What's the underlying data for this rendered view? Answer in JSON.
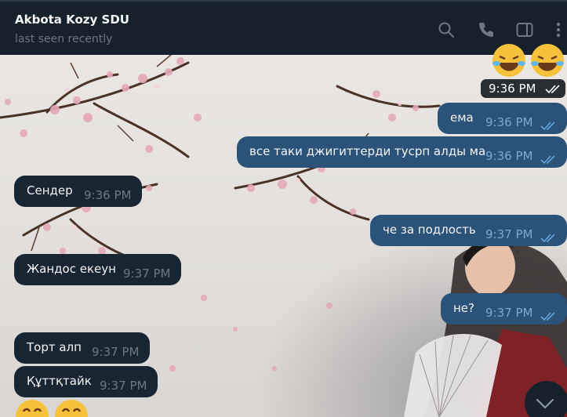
{
  "header": {
    "title": "Akbota Kozy SDU",
    "status": "last seen recently",
    "icons": [
      "search-icon",
      "phone-icon",
      "sidebar-toggle-icon",
      "more-options-icon"
    ]
  },
  "top_time": "9:36 PM",
  "messages": [
    {
      "dir": "out",
      "text": "ема",
      "time": "9:36 PM"
    },
    {
      "dir": "out",
      "text": "все таки джигиттерди тусрп алды ма",
      "time": "9:36 PM"
    },
    {
      "dir": "in",
      "text": "Сендер",
      "time": "9:36 PM"
    },
    {
      "dir": "out",
      "text": "че за подлость",
      "time": "9:37 PM"
    },
    {
      "dir": "in",
      "text": "Жандос екеун",
      "time": "9:37 PM"
    },
    {
      "dir": "out",
      "text": "не?",
      "time": "9:37 PM"
    },
    {
      "dir": "in",
      "text": "Торт алп",
      "time": "9:37 PM"
    },
    {
      "dir": "in",
      "text": "Құттқтайк",
      "time": "9:37 PM"
    }
  ],
  "colors": {
    "header_bg": "#17212b",
    "incoming_bubble": "#182533",
    "outgoing_bubble": "#2b5278",
    "outgoing_time": "#7da8d3",
    "checkmarks": "#5fa7e3"
  }
}
